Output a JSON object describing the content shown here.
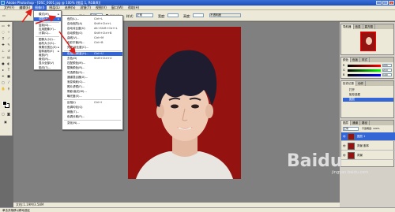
{
  "window": {
    "title": "Adobe Photoshop - [DSC_0001.jpg @ 100% (图层 1, RGB/8)]"
  },
  "menu": [
    "文件(F)",
    "编辑(E)",
    "图像(I)",
    "图层(L)",
    "选择(S)",
    "滤镜(T)",
    "视图(V)",
    "窗口(W)",
    "帮助(H)"
  ],
  "options": {
    "feather_label": "羽化:",
    "feather_value": "0 px",
    "antialias_label": "消除锯齿",
    "style_label": "样式:",
    "style_value": "正常",
    "width_label": "宽度:",
    "height_label": "高度:",
    "workspace_label": "不透明度"
  },
  "image_menu": {
    "items": [
      {
        "label": "模式(M)",
        "arrow": true
      },
      {
        "label": "调整(A)",
        "arrow": true,
        "highlight": true
      },
      {
        "label": "复制(D)..."
      },
      {
        "label": "应用图像(Y)..."
      },
      {
        "label": "计算(C)..."
      },
      {
        "label": "图像大小(I)..."
      },
      {
        "label": "画布大小(S)..."
      },
      {
        "label": "像素长宽比(X)",
        "arrow": true
      },
      {
        "label": "旋转画布(E)",
        "arrow": true
      },
      {
        "label": "裁剪(P)"
      },
      {
        "label": "裁切(R)..."
      },
      {
        "label": "显示全部(V)"
      },
      {
        "label": "陷印(T)..."
      }
    ]
  },
  "adjust_menu": {
    "items": [
      {
        "label": "色阶(L)...",
        "shortcut": "Ctrl+L"
      },
      {
        "label": "自动色阶(A)",
        "shortcut": "Shift+Ctrl+L"
      },
      {
        "label": "自动对比度(U)",
        "shortcut": "Alt+Shift+Ctrl+L"
      },
      {
        "label": "自动颜色(O)",
        "shortcut": "Shift+Ctrl+B"
      },
      {
        "label": "曲线(V)...",
        "shortcut": "Ctrl+M"
      },
      {
        "label": "色彩平衡(B)...",
        "shortcut": "Ctrl+B"
      },
      {
        "label": "亮度/对比度(C)..."
      },
      {
        "label": "色相/饱和度(H)...",
        "shortcut": "Ctrl+U",
        "highlight": true
      },
      {
        "label": "去色(D)",
        "shortcut": "Shift+Ctrl+U"
      },
      {
        "label": "匹配颜色(M)..."
      },
      {
        "label": "替换颜色(R)..."
      },
      {
        "label": "可选颜色(S)..."
      },
      {
        "label": "通道混合器(X)..."
      },
      {
        "label": "渐变映射(G)..."
      },
      {
        "label": "照片滤镜(F)..."
      },
      {
        "label": "阴影/高光(W)..."
      },
      {
        "label": "曝光度(E)..."
      },
      {
        "label": "反相(I)",
        "shortcut": "Ctrl+I"
      },
      {
        "label": "色调均化(Q)"
      },
      {
        "label": "阈值(T)..."
      },
      {
        "label": "色调分离(P)..."
      },
      {
        "label": "变化(N)..."
      }
    ]
  },
  "document": {
    "title": "DSC_0001.jpg @ 100% (图层 1, RGB/8)",
    "status": "文档:1.19M/3.58M"
  },
  "panels": {
    "navigator_tabs": [
      "导航器",
      "信息",
      "直方图"
    ],
    "color_tabs": [
      "颜色",
      "色板",
      "样式"
    ],
    "color_values": {
      "r": "255",
      "g": "210",
      "b": "190"
    },
    "history_tabs": [
      "历史记录",
      "动作"
    ],
    "history_items": [
      "打开",
      "矩形选框",
      "图层"
    ],
    "layers_tabs": [
      "图层",
      "通道",
      "路径"
    ],
    "layers_mode": "正常",
    "layers_opacity": "不透明度: 100%",
    "layers": [
      "图层 1",
      "背景 副本",
      "背景"
    ]
  },
  "taskbar": {
    "text": "单击并拖移以移动选区"
  },
  "watermark": {
    "text": "Baidu",
    "sub": "jingyan.baidu.com"
  },
  "colors": {
    "photo_bg": "#941310",
    "menu_highlight": "#3466d6",
    "arrow_red": "#e0201a"
  }
}
